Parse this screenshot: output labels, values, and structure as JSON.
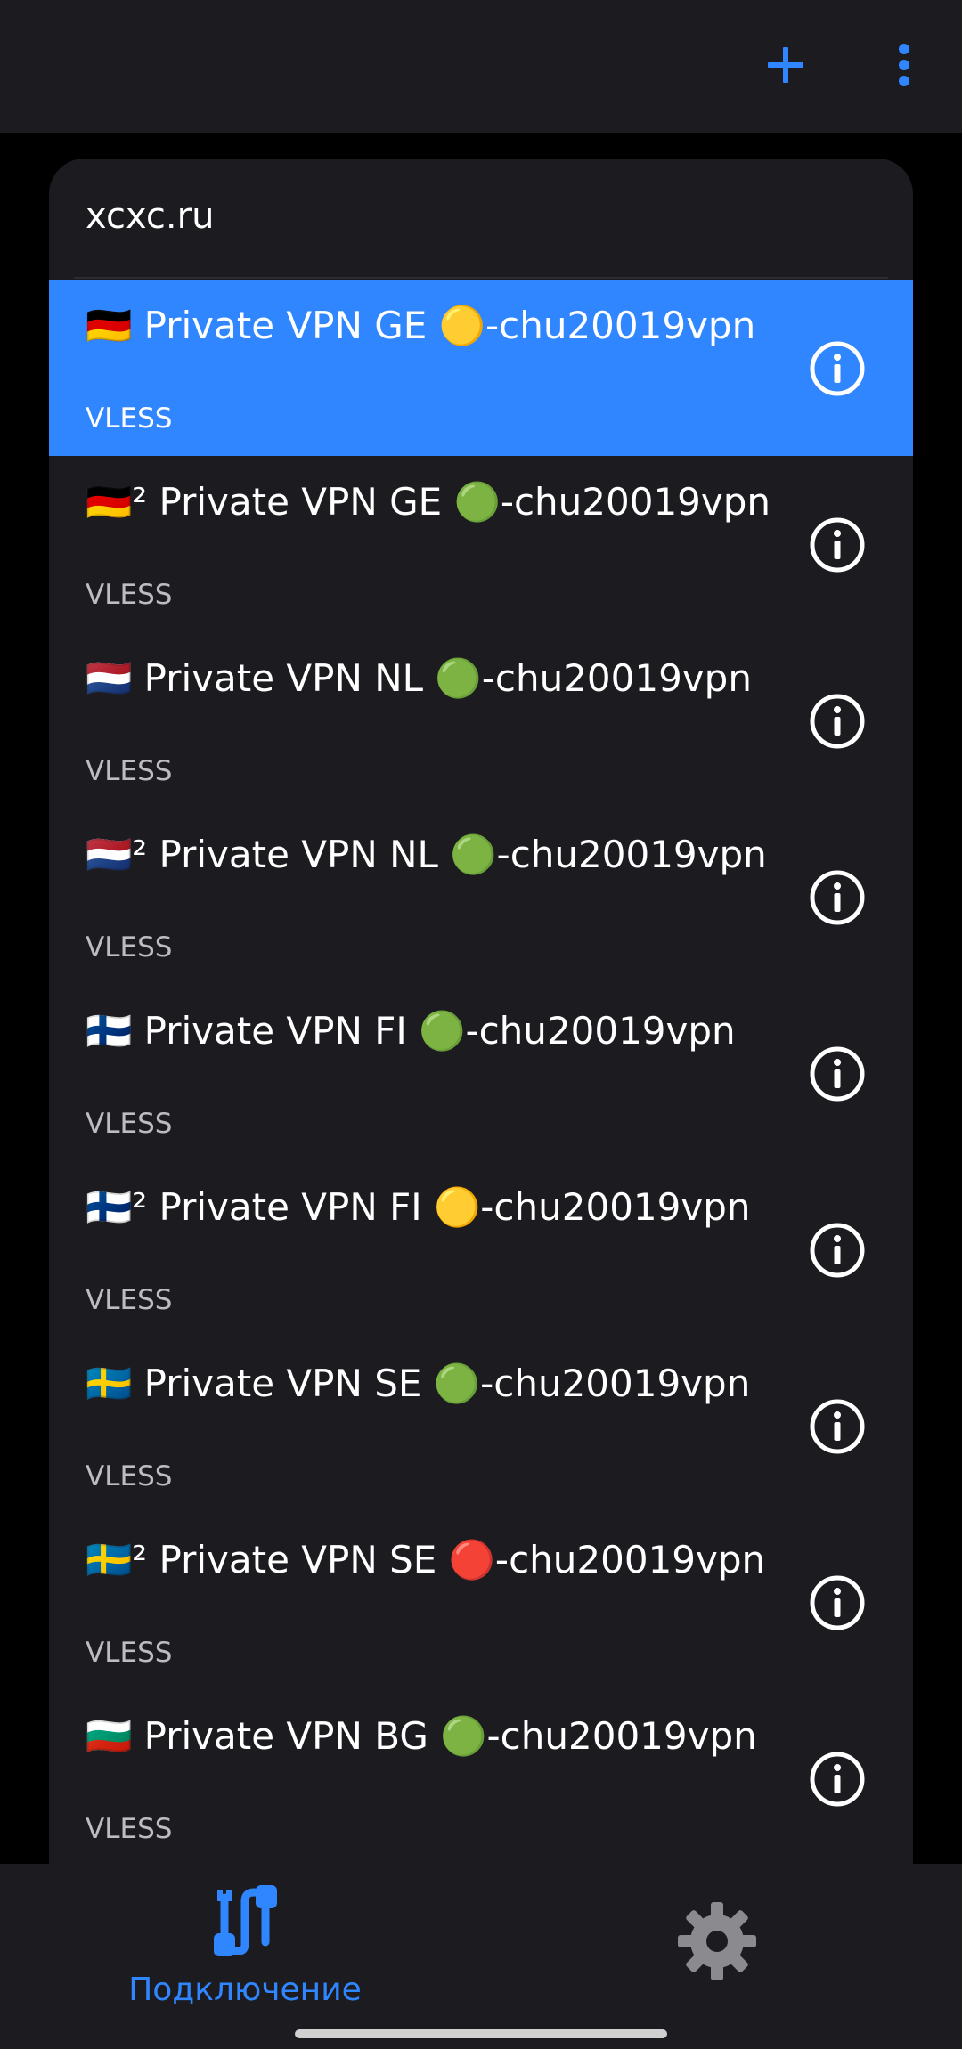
{
  "app_bar": {
    "add_icon": "plus-icon",
    "more_icon": "more-vertical-icon",
    "accent": "#2f86ff"
  },
  "subscription": {
    "title": "xcxc.ru"
  },
  "servers": [
    {
      "name": "🇩🇪 Private VPN GE 🟡-chu20019vpn",
      "protocol": "VLESS",
      "selected": true
    },
    {
      "name": "🇩🇪² Private VPN GE 🟢-chu20019vpn",
      "protocol": "VLESS",
      "selected": false
    },
    {
      "name": "🇳🇱 Private VPN NL 🟢-chu20019vpn",
      "protocol": "VLESS",
      "selected": false
    },
    {
      "name": "🇳🇱² Private VPN NL 🟢-chu20019vpn",
      "protocol": "VLESS",
      "selected": false
    },
    {
      "name": "🇫🇮 Private VPN FI 🟢-chu20019vpn",
      "protocol": "VLESS",
      "selected": false
    },
    {
      "name": "🇫🇮² Private VPN FI 🟡-chu20019vpn",
      "protocol": "VLESS",
      "selected": false
    },
    {
      "name": "🇸🇪 Private VPN SE 🟢-chu20019vpn",
      "protocol": "VLESS",
      "selected": false
    },
    {
      "name": "🇸🇪² Private VPN SE 🔴-chu20019vpn",
      "protocol": "VLESS",
      "selected": false
    },
    {
      "name": "🇧🇬 Private VPN BG 🟢-chu20019vpn",
      "protocol": "VLESS",
      "selected": false
    }
  ],
  "bottom_nav": {
    "connection_label": "Подключение",
    "connection_icon": "connection-plug-icon",
    "settings_icon": "gear-icon"
  },
  "colors": {
    "surface": "#1c1b1f",
    "selected": "#2f86ff",
    "secondary_text": "#bdbcc2",
    "icon_inactive": "#8a8a8f"
  }
}
